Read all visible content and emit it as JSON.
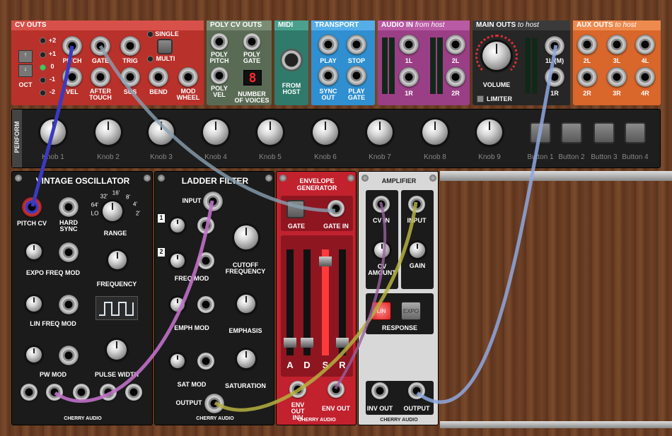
{
  "cv_outs": {
    "title": "CV OUTS",
    "octave_values": [
      "+2",
      "+1",
      "0",
      "-1",
      "-2"
    ],
    "oct_label": "OCT",
    "single": "SINGLE",
    "multi": "MULTI",
    "jacks": [
      "PITCH",
      "GATE",
      "TRIG",
      "VEL",
      "AFTER TOUCH",
      "SUS",
      "BEND",
      "MOD WHEEL"
    ]
  },
  "poly_cv_outs": {
    "title": "POLY CV OUTS",
    "poly_pitch": "POLY PITCH",
    "poly_gate": "POLY GATE",
    "poly_vel": "POLY VEL",
    "num_voices_label": "NUMBER OF VOICES",
    "num_voices": "8"
  },
  "midi": {
    "title": "MIDI",
    "from_host": "FROM HOST"
  },
  "transport": {
    "title": "TRANSPORT",
    "labels": [
      "PLAY",
      "STOP",
      "SYNC OUT",
      "PLAY GATE"
    ]
  },
  "audio_in": {
    "title": "AUDIO IN",
    "subtitle": "from host",
    "labels": [
      "1L",
      "2L",
      "1R",
      "2R"
    ]
  },
  "main_outs": {
    "title": "MAIN OUTS",
    "subtitle": "to host",
    "volume": "VOLUME",
    "limiter": "LIMITER",
    "labels": [
      "1L (M)",
      "1R"
    ]
  },
  "aux_outs": {
    "title": "AUX OUTS",
    "subtitle": "to host",
    "labels": [
      "2L",
      "3L",
      "4L",
      "2R",
      "3R",
      "4R"
    ]
  },
  "perform": {
    "title": "PERFORM",
    "knobs": [
      "Knob 1",
      "Knob 2",
      "Knob 3",
      "Knob 4",
      "Knob 5",
      "Knob 6",
      "Knob 7",
      "Knob 8",
      "Knob 9"
    ],
    "buttons": [
      "Button 1",
      "Button 2",
      "Button 3",
      "Button 4"
    ]
  },
  "vco": {
    "title": "VINTAGE OSCILLATOR",
    "pitch_cv": "PITCH CV",
    "hard_sync": "HARD SYNC",
    "range": "RANGE",
    "range_ticks": [
      "64'",
      "32'",
      "16'",
      "8'",
      "4'",
      "2'",
      "LO"
    ],
    "expo": "EXPO FREQ MOD",
    "frequency": "FREQUENCY",
    "lin": "LIN FREQ MOD",
    "pw_mod": "PW MOD",
    "pulse_width": "PULSE WIDTH",
    "brand": "CHERRY AUDIO"
  },
  "filter": {
    "title": "LADDER FILTER",
    "input": "INPUT",
    "freq_mod": "FREQ MOD",
    "cutoff": "CUTOFF FREQUENCY",
    "emph_mod": "EMPH MOD",
    "emphasis": "EMPHASIS",
    "sat_mod": "SAT MOD",
    "saturation": "SATURATION",
    "output": "OUTPUT",
    "brand": "CHERRY AUDIO",
    "num1": "1",
    "num2": "2"
  },
  "envelope": {
    "title": "ENVELOPE GENERATOR",
    "gate": "GATE",
    "gate_in": "GATE IN",
    "adsr": [
      "A",
      "D",
      "S",
      "R"
    ],
    "env_out_inv": "ENV OUT INV",
    "env_out": "ENV OUT",
    "brand": "CHERRY AUDIO"
  },
  "amplifier": {
    "title": "AMPLIFIER",
    "cv_in": "CV IN",
    "input": "INPUT",
    "cv_amount": "CV AMOUNT",
    "gain": "GAIN",
    "lin": "LIN",
    "expo": "EXPO",
    "response": "RESPONSE",
    "inv_out": "INV OUT",
    "output": "OUTPUT",
    "brand": "CHERRY AUDIO"
  },
  "colors": {
    "cv_outs": "#b8312b",
    "poly": "#5a6b55",
    "midi": "#2f7a6a",
    "transport": "#2f8fd0",
    "audio_in": "#9a3f86",
    "main_outs": "#262626",
    "aux_outs": "#d9662a",
    "cable_blue": "#3a3ac0",
    "cable_gray": "#8aa0b0",
    "cable_purple": "#c070c8",
    "cable_olive": "#b5b040",
    "cable_lightblue": "#8fa8e0"
  }
}
